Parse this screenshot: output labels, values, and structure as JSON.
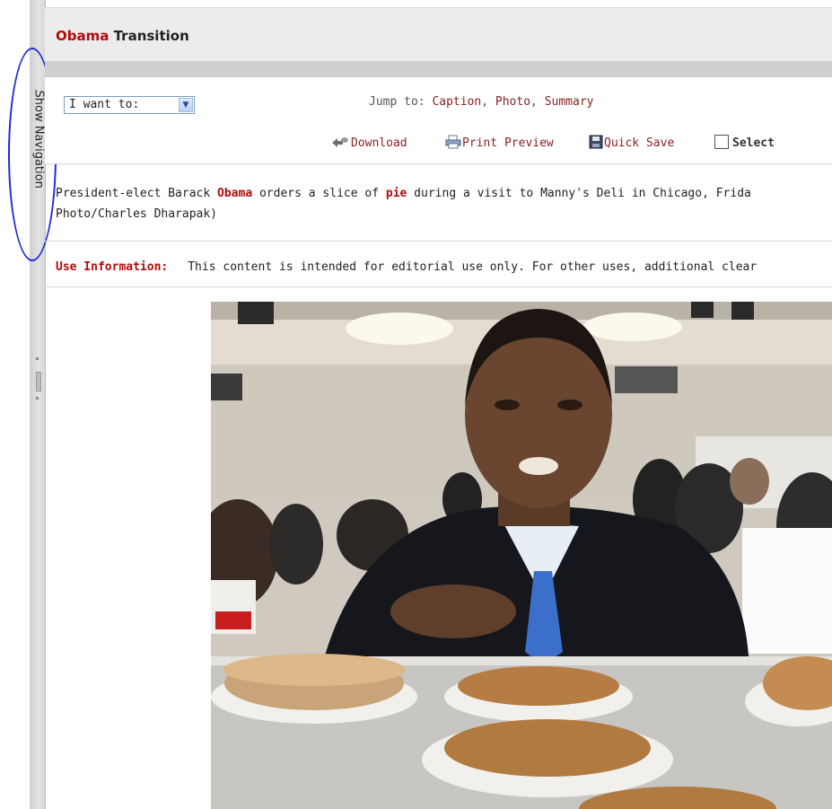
{
  "page": {
    "title_highlight": "Obama",
    "title_rest": " Transition"
  },
  "nav": {
    "show_navigation_label": "Show Navigation"
  },
  "toolbar": {
    "i_want_to": "I want to:",
    "jump_prefix": "Jump to: ",
    "jump_links": [
      "Caption",
      "Photo",
      "Summary"
    ],
    "jump_sep": ", ",
    "download": "Download",
    "print_preview": "Print Preview",
    "quick_save": "Quick Save",
    "select": "Select"
  },
  "caption": {
    "p1": "President-elect Barack ",
    "hl1": "Obama",
    "p2": " orders a slice of ",
    "hl2": "pie",
    "p3": " during a visit to Manny's Deli in Chicago, Frida",
    "line2": "Photo/Charles Dharapak)"
  },
  "use_info": {
    "label": "Use Information:",
    "text": "This content is intended for editorial use only. For other uses, additional clear"
  },
  "icons": {
    "dropdown": "chevron-down-icon",
    "download": "download-icon",
    "print": "printer-icon",
    "save": "floppy-disk-icon",
    "checkbox": "checkbox-icon"
  },
  "colors": {
    "accent_red": "#b20a0a",
    "link": "#8a1f1f",
    "annotation_circle": "#1f2ad8"
  }
}
